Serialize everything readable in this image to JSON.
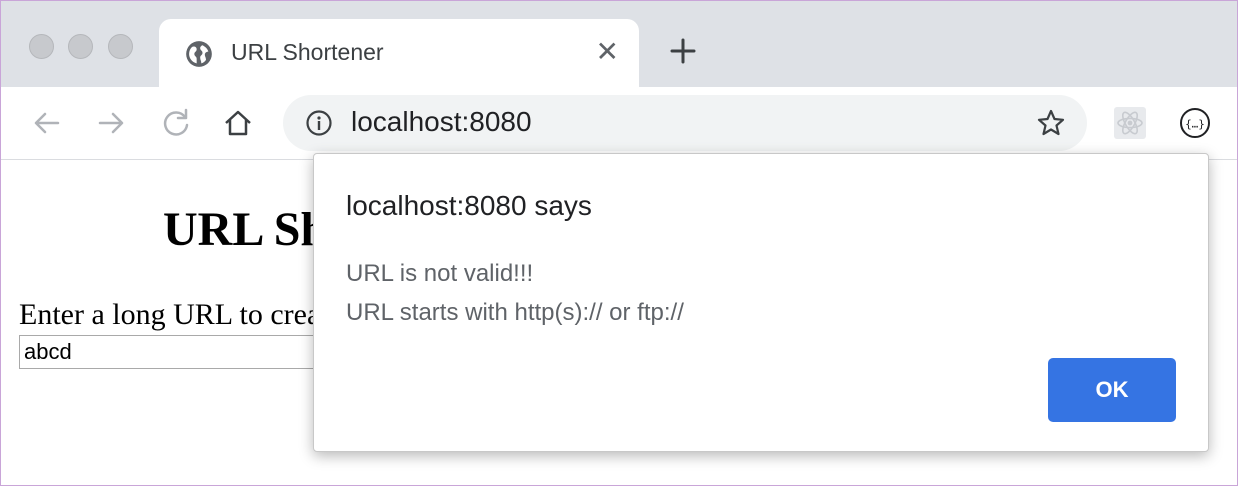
{
  "tab": {
    "title": "URL Shortener"
  },
  "toolbar": {
    "url": "localhost:8080"
  },
  "page": {
    "heading": "URL Shortener",
    "label": "Enter a long URL to create a short URL",
    "input_value": "abcd"
  },
  "dialog": {
    "title": "localhost:8080 says",
    "message_line1": "URL is not valid!!!",
    "message_line2": "URL starts with http(s):// or ftp://",
    "ok_label": "OK"
  },
  "colors": {
    "accent": "#3574e3",
    "tabstrip": "#dee1e6",
    "omnibox": "#f1f3f4"
  }
}
